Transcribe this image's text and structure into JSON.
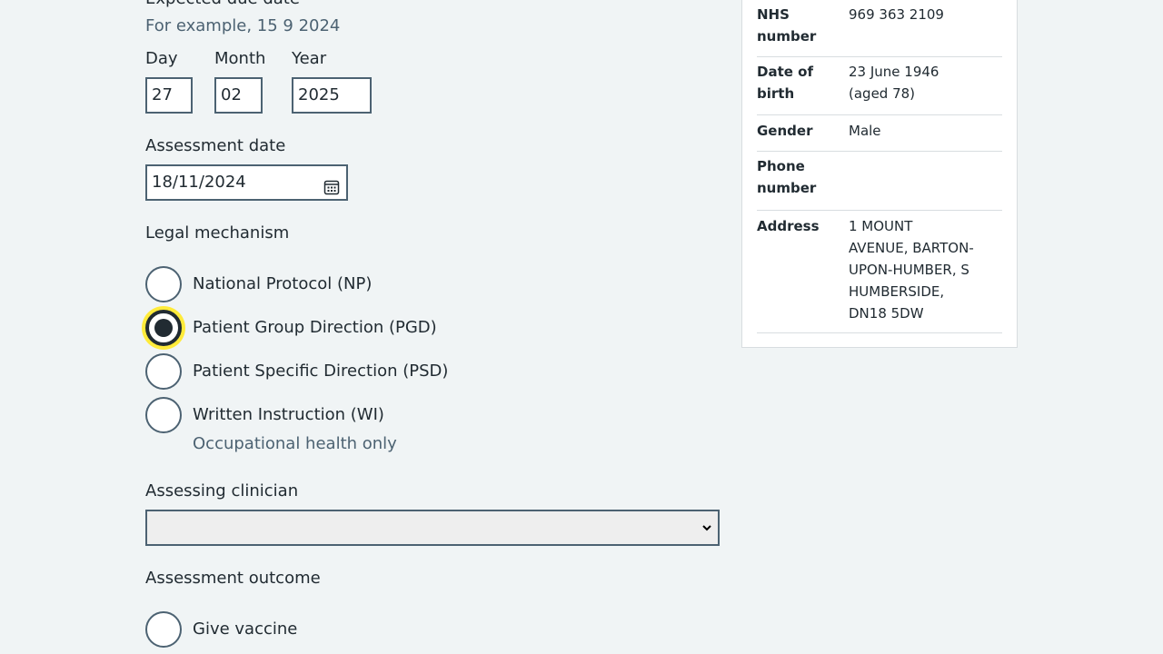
{
  "form": {
    "due_date": {
      "heading": "Expected due date",
      "hint": "For example, 15 9 2024",
      "day_label": "Day",
      "day_value": "27",
      "month_label": "Month",
      "month_value": "02",
      "year_label": "Year",
      "year_value": "2025"
    },
    "assessment_date": {
      "label": "Assessment date",
      "value": "18/11/2024",
      "icon": "calendar-icon"
    },
    "legal_mechanism": {
      "label": "Legal mechanism",
      "options": [
        {
          "label": "National Protocol (NP)",
          "checked": false
        },
        {
          "label": "Patient Group Direction (PGD)",
          "checked": true
        },
        {
          "label": "Patient Specific Direction (PSD)",
          "checked": false
        },
        {
          "label": "Written Instruction (WI)",
          "checked": false,
          "hint": "Occupational health only"
        }
      ]
    },
    "assessing_clinician": {
      "label": "Assessing clinician",
      "selected": ""
    },
    "assessment_outcome": {
      "label": "Assessment outcome",
      "options": [
        {
          "label": "Give vaccine",
          "checked": false
        }
      ]
    }
  },
  "patient": {
    "rows": [
      {
        "key_line1": "NHS",
        "key_line2": "number",
        "val_line1": "969 363 2109"
      },
      {
        "key_line1": "Date of",
        "key_line2": "birth",
        "val_line1": "23 June 1946",
        "val_line2": "(aged 78)"
      },
      {
        "key_line1": "Gender",
        "val_line1": "Male"
      },
      {
        "key_line1": "Phone",
        "key_line2": "number",
        "val_line1": ""
      },
      {
        "key_line1": "Address",
        "val_line1": "1 MOUNT",
        "val_line2": "AVENUE, BARTON-",
        "val_line3": "UPON-HUMBER, S",
        "val_line4": "HUMBERSIDE,",
        "val_line5": "DN18 5DW"
      }
    ]
  },
  "colors": {
    "background": "#f0f4f5",
    "text": "#212b32",
    "hint": "#4c6272",
    "border": "#4c6272",
    "focus": "#ffeb3b"
  }
}
